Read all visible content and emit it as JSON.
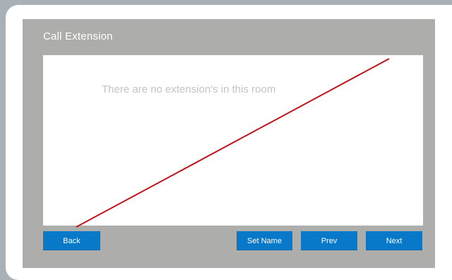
{
  "panel": {
    "title": "Call Extension",
    "empty_message": "There are no extension's in this room"
  },
  "buttons": {
    "back": "Back",
    "set_name": "Set Name",
    "prev": "Prev",
    "next": "Next"
  },
  "colors": {
    "panel_bg": "#adaeac",
    "button_bg": "#0878c8",
    "annotation_line": "#c0161b"
  }
}
